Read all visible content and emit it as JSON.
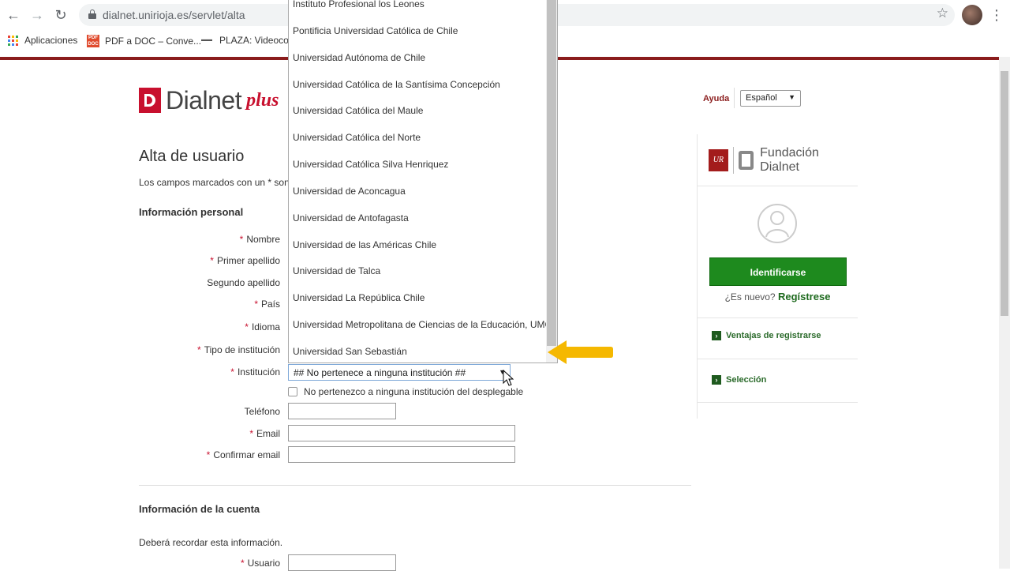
{
  "browser": {
    "url": "dialnet.unirioja.es/servlet/alta",
    "back_icon": "←",
    "forward_icon": "→",
    "reload_icon": "↻",
    "star_icon": "☆",
    "menu_icon": "⋮",
    "bookmarks": [
      {
        "label": "Aplicaciones"
      },
      {
        "label": "PDF a DOC – Conve..."
      },
      {
        "label": "PLAZA: Videocon"
      }
    ]
  },
  "header": {
    "logo_text": "Dialnet",
    "logo_plus": "plus",
    "help": "Ayuda",
    "language": "Español"
  },
  "form": {
    "title": "Alta de usuario",
    "required_note": "Los campos marcados con un * son d",
    "personal_section": "Información personal",
    "required_mark": "*",
    "labels": {
      "nombre": "Nombre",
      "primer_apellido": "Primer apellido",
      "segundo_apellido": "Segundo apellido",
      "pais": "País",
      "idioma": "Idioma",
      "tipo_institucion": "Tipo de institución",
      "institucion": "Institución",
      "telefono": "Teléfono",
      "email": "Email",
      "confirmar_email": "Confirmar email",
      "usuario": "Usuario"
    },
    "institution_value": "## No pertenece a ninguna institución ##",
    "checkbox_label": "No pertenezco a ninguna institución del desplegable",
    "account_section": "Información de la cuenta",
    "account_note": "Deberá recordar esta información."
  },
  "dropdown": {
    "items": [
      "Instituto Profesional los Leones",
      "Pontificia Universidad Católica de Chile",
      "Universidad Autónoma de Chile",
      "Universidad Católica de la Santísima Concepción",
      "Universidad Católica del Maule",
      "Universidad Católica del Norte",
      "Universidad Católica Silva Henriquez",
      "Universidad de Aconcagua",
      "Universidad de Antofagasta",
      "Universidad de las Américas Chile",
      "Universidad de Talca",
      "Universidad La República Chile",
      "Universidad Metropolitana de Ciencias de la Educación, UMCE",
      "Universidad San Sebastián"
    ]
  },
  "sidebar": {
    "foundation_text": "Fundación Dialnet",
    "login_button": "Identificarse",
    "new_user_prefix": "¿Es nuevo?",
    "register_link": "Regístrese",
    "links": [
      "Ventajas de registrarse",
      "Selección"
    ]
  },
  "colors": {
    "brand_red": "#8a1c1c",
    "logo_red": "#c8102e",
    "login_green": "#1e8a1e",
    "highlight_arrow": "#f5b800"
  }
}
